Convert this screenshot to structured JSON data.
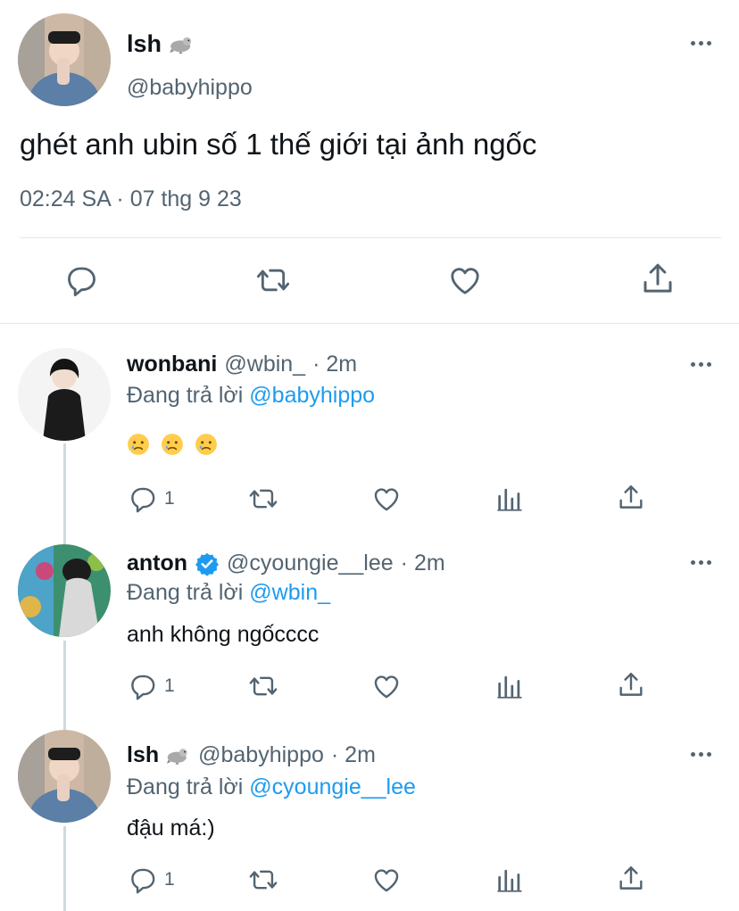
{
  "main_tweet": {
    "name": "lsh",
    "handle": "@babyhippo",
    "text": "ghét anh ubin số 1 thế giới tại ảnh ngốc",
    "timestamp": "02:24 SA · 07 thg 9 23",
    "name_emoji": "seal-emoji",
    "actions": [
      "reply-icon",
      "retweet-icon",
      "like-icon",
      "share-icon"
    ]
  },
  "replies": [
    {
      "name": "wonbani",
      "handle": "@wbin_",
      "time": "· 2m",
      "replying_prefix": "Đang trả lời",
      "replying_to": "@babyhippo",
      "text": "😢 😢 😢",
      "reply_count": "1"
    },
    {
      "name": "anton",
      "verified": true,
      "handle": "@cyoungie__lee",
      "time": "· 2m",
      "replying_prefix": "Đang trả lời",
      "replying_to": "@wbin_",
      "text": "anh không ngốcccc",
      "reply_count": "1"
    },
    {
      "name": "lsh",
      "name_emoji": "seal-emoji",
      "handle": "@babyhippo",
      "time": "· 2m",
      "replying_prefix": "Đang trả lời",
      "replying_to": "@cyoungie__lee",
      "text": "đậu má:)",
      "reply_count": "1"
    }
  ],
  "colors": {
    "text": "#0f1419",
    "muted": "#536471",
    "link": "#1d9bf0",
    "verified": "#1d9bf0",
    "divider": "#e1e8ed"
  }
}
